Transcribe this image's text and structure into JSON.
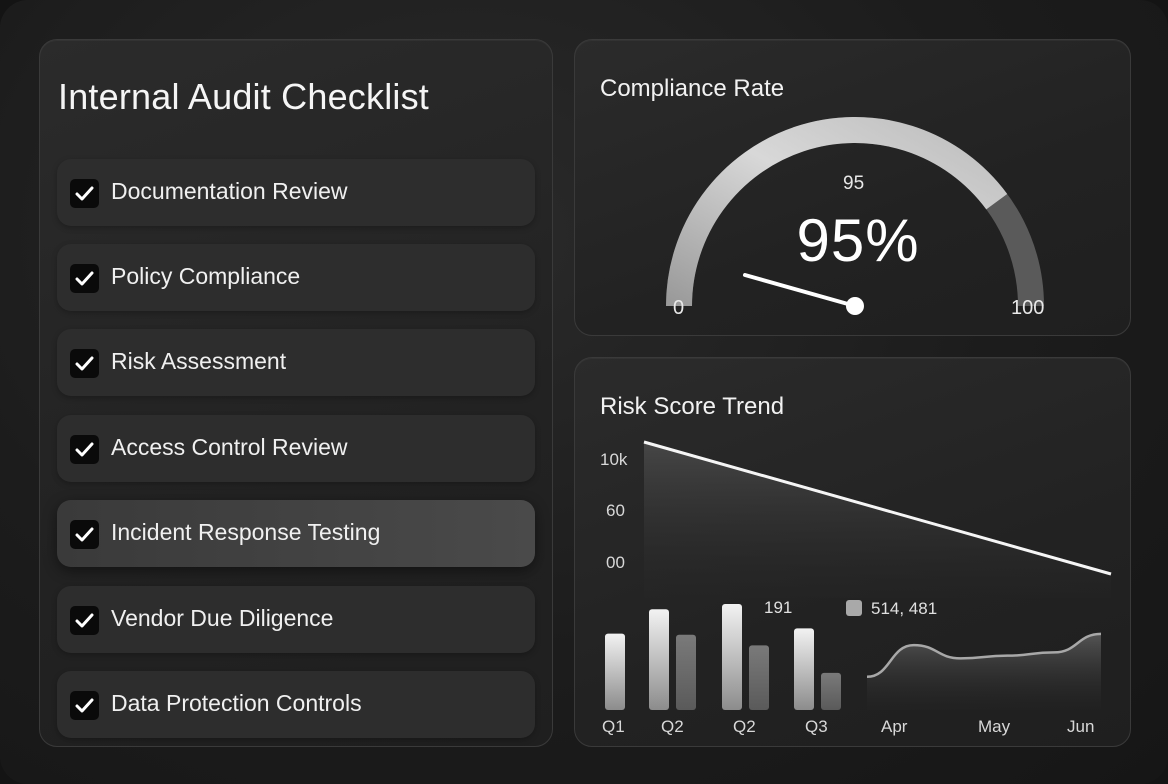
{
  "checklist": {
    "title": "Internal Audit Checklist",
    "items": [
      {
        "label": "Documentation Review",
        "checked": true
      },
      {
        "label": "Policy Compliance",
        "checked": true
      },
      {
        "label": "Risk Assessment",
        "checked": true
      },
      {
        "label": "Access Control Review",
        "checked": true
      },
      {
        "label": "Incident Response Testing",
        "checked": true,
        "highlighted": true
      },
      {
        "label": "Vendor Due Diligence",
        "checked": true
      },
      {
        "label": "Data Protection Controls",
        "checked": true
      }
    ]
  },
  "gauge": {
    "title": "Compliance Rate",
    "value_label": "95",
    "percent_label": "95%",
    "min_label": "0",
    "max_label": "100",
    "value": 95,
    "min": 0,
    "max": 100
  },
  "trend": {
    "title": "Risk Score Trend",
    "y_ticks": [
      "10k",
      "60",
      "00"
    ],
    "bar_x_labels": [
      "Q1",
      "Q2",
      "Q2",
      "Q3"
    ],
    "bar_annotation": "191",
    "legend_label": "514, 481",
    "line_x_labels": [
      "Apr",
      "May",
      "Jun"
    ]
  },
  "chart_data": [
    {
      "type": "area",
      "title": "Risk Score Trend",
      "y_tick_labels": [
        "10k",
        "60",
        "00"
      ],
      "trend": "decreasing",
      "values": [
        100,
        0
      ]
    },
    {
      "type": "bar",
      "categories": [
        "Q1",
        "Q2",
        "Q2",
        "Q3"
      ],
      "series": [
        {
          "values": [
            72,
            95,
            100,
            77
          ]
        },
        {
          "values": [
            null,
            71,
            61,
            35
          ]
        }
      ],
      "annotation": "191"
    },
    {
      "type": "area",
      "categories": [
        "Apr",
        "May",
        "Jun"
      ],
      "legend": "514, 481",
      "values": [
        20,
        68,
        48,
        52,
        57,
        85
      ]
    }
  ],
  "colors": {
    "background": "#1c1c1c",
    "panel": "#262626",
    "accent_light": "#d9d9d9",
    "accent_mid": "#7a7a7a",
    "check_box": "#0a0a0a"
  }
}
